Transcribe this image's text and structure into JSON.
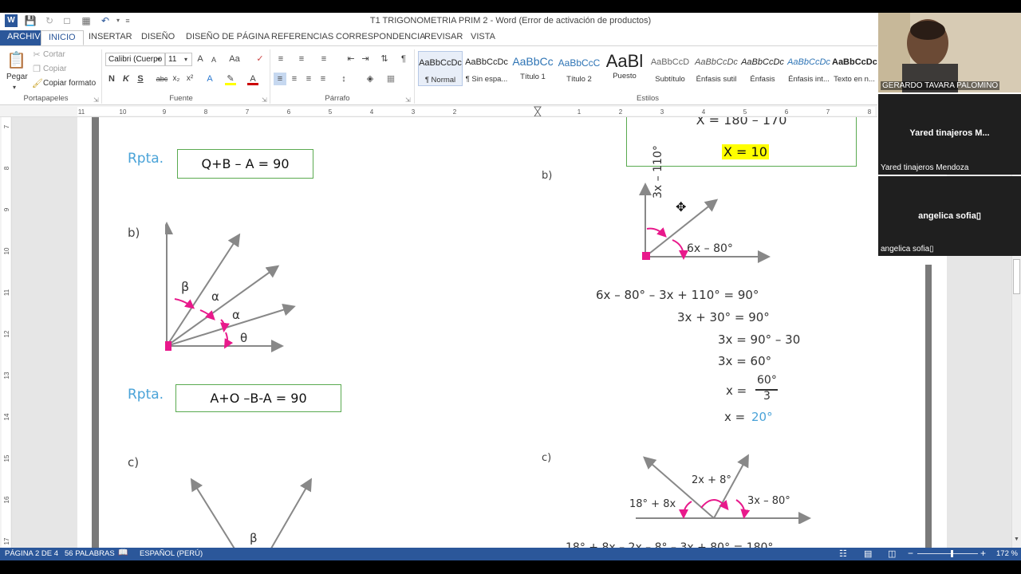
{
  "window": {
    "title": "T1 TRIGONOMETRIA  PRIM 2 - Word (Error de activación de productos)"
  },
  "tabs": [
    "ARCHIVO",
    "INICIO",
    "INSERTAR",
    "DISEÑO",
    "DISEÑO DE PÁGINA",
    "REFERENCIAS",
    "CORRESPONDENCIA",
    "REVISAR",
    "VISTA"
  ],
  "clipboard": {
    "paste": "Pegar",
    "cut": "Cortar",
    "copy": "Copiar",
    "format_painter": "Copiar formato",
    "label": "Portapapeles"
  },
  "font": {
    "name": "Calibri (Cuerpo",
    "size": "11",
    "label": "Fuente",
    "bold": "N",
    "italic": "K",
    "underline": "S",
    "strike": "abc",
    "subscript": "x₂",
    "superscript": "x²",
    "grow": "A",
    "shrink": "A",
    "case": "Aa"
  },
  "paragraph": {
    "label": "Párrafo"
  },
  "styles": {
    "label": "Estilos",
    "items": [
      {
        "preview": "AaBbCcDc",
        "name": "¶ Normal"
      },
      {
        "preview": "AaBbCcDc",
        "name": "¶ Sin espa..."
      },
      {
        "preview": "AaBbCc",
        "name": "Título 1"
      },
      {
        "preview": "AaBbCcC",
        "name": "Título 2"
      },
      {
        "preview": "AaBl",
        "name": "Puesto"
      },
      {
        "preview": "AaBbCcD",
        "name": "Subtítulo"
      },
      {
        "preview": "AaBbCcDc",
        "name": "Énfasis sutil"
      },
      {
        "preview": "AaBbCcDc",
        "name": "Énfasis"
      },
      {
        "preview": "AaBbCcDc",
        "name": "Énfasis int..."
      },
      {
        "preview": "AaBbCcDc",
        "name": "Texto en n..."
      }
    ]
  },
  "ruler": {
    "left_numbers": [
      "11",
      "10",
      "9",
      "8",
      "7",
      "6",
      "5",
      "4",
      "3",
      "2"
    ],
    "right_numbers": [
      "1",
      "2",
      "3",
      "4",
      "5",
      "6",
      "7",
      "8"
    ],
    "v_numbers": [
      "7",
      "8",
      "9",
      "10",
      "11",
      "12",
      "13",
      "14",
      "15",
      "16",
      "17"
    ]
  },
  "document": {
    "top_equation": "X = 180 – 170",
    "x_result": "X = 10",
    "rpta_label": "Rpta.",
    "answer1": "Q+B – A = 90",
    "answer2": "A+O –B-A = 90",
    "label_b": "b)",
    "label_c": "c)",
    "diag_left_b": {
      "beta": "β",
      "alpha1": "α",
      "alpha2": "α",
      "theta": "θ"
    },
    "diag_right_b": {
      "vertical": "3x – 110°",
      "angle": "6x – 80°"
    },
    "solution": [
      "6x – 80° – 3x + 110° = 90°",
      "3x + 30° = 90°",
      "3x = 90° – 30",
      "3x = 60°"
    ],
    "frac_prefix": "x =",
    "frac_num": "60°",
    "frac_den": "3",
    "final_prefix": "x =",
    "final_value": "20°",
    "diag_right_c": {
      "top": "2x + 8°",
      "left": "18° + 8x",
      "right": "3x – 80°"
    },
    "diag_left_c": {
      "beta": "β"
    },
    "cut_line": "18° + 8x – 2x – 8° – 3x + 80° = 180°"
  },
  "status": {
    "page": "PÁGINA 2 DE 4",
    "words": "56 PALABRAS",
    "language": "ESPAÑOL (PERÚ)",
    "zoom": "172 %"
  },
  "participants": [
    {
      "name": "GERARDO TAVARA PALOMINO"
    },
    {
      "center": "Yared tinajeros M...",
      "name": "Yared tinajeros Mendoza"
    },
    {
      "center": "angelica sofia▯",
      "name": "angelica sofia▯"
    }
  ],
  "colors": {
    "word_blue": "#2b579a",
    "answer_green": "#5aaa50",
    "rpta_blue": "#4aa3d8",
    "angle_magenta": "#e8198b",
    "highlight": "#ffff00"
  }
}
